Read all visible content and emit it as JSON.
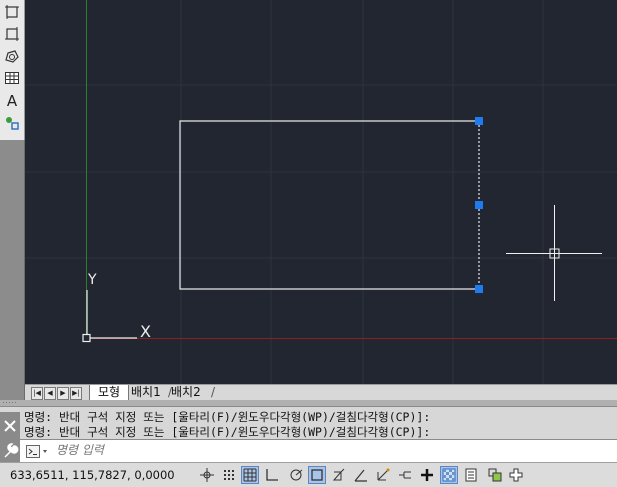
{
  "left_toolbar": {
    "tools": [
      {
        "icon": "rectangle-dims-icon"
      },
      {
        "icon": "stretch-box-icon"
      },
      {
        "icon": "region-icon"
      },
      {
        "icon": "table-icon"
      },
      {
        "icon": "text-icon",
        "glyph": "A"
      },
      {
        "icon": "block-insert-icon"
      }
    ]
  },
  "viewport": {
    "ucs_x_label": "X",
    "ucs_y_label": "Y",
    "background": "#212631",
    "grid_color": "#2c3240",
    "y_axis_color": "#2e7d32",
    "x_axis_color": "#8e1f1f",
    "grip_color": "#1e7cf0"
  },
  "layout_tabs": {
    "nav_buttons": [
      "|◀",
      "◀",
      "▶",
      "▶|"
    ],
    "tabs": [
      "모형",
      "배치1",
      "배치2"
    ],
    "active": "모형"
  },
  "command_history": {
    "lines": [
      "명령: 반대 구석 지정 또는 [울타리(F)/윈도우다각형(WP)/걸침다각형(CP)]:",
      "명령: 반대 구석 지정 또는 [울타리(F)/윈도우다각형(WP)/걸침다각형(CP)]:"
    ],
    "close_icon": "close-icon",
    "settings_icon": "wrench-icon"
  },
  "command_input": {
    "placeholder": "명령 입력",
    "prompt_icon": "command-prompt-icon"
  },
  "status_bar": {
    "coordinates": "633,6511, 115,7827, 0,0000",
    "toggles": [
      {
        "name": "infer-constraints",
        "icon": "infer-icon",
        "active": false
      },
      {
        "name": "snap",
        "icon": "snap-grid-icon",
        "active": false
      },
      {
        "name": "grid",
        "icon": "grid-icon",
        "active": true
      },
      {
        "name": "ortho",
        "icon": "ortho-icon",
        "active": false
      },
      {
        "name": "polar",
        "icon": "polar-icon",
        "active": false
      },
      {
        "name": "osnap",
        "icon": "osnap-icon",
        "active": true
      },
      {
        "name": "3d-osnap",
        "icon": "3d-osnap-icon",
        "active": false
      },
      {
        "name": "otrack",
        "icon": "otrack-icon",
        "active": false
      },
      {
        "name": "ducs",
        "icon": "ducs-icon",
        "active": false
      },
      {
        "name": "dyn",
        "icon": "dyn-icon",
        "active": false
      },
      {
        "name": "lineweight",
        "icon": "lineweight-icon",
        "active": false
      },
      {
        "name": "transparency",
        "icon": "transparency-icon",
        "active": true
      },
      {
        "name": "quick-properties",
        "icon": "quick-properties-icon",
        "active": false
      },
      {
        "name": "selection-cycling",
        "icon": "selection-cycling-icon",
        "active": false
      },
      {
        "name": "annotation-monitor",
        "icon": "annotation-monitor-icon",
        "active": false
      }
    ]
  }
}
